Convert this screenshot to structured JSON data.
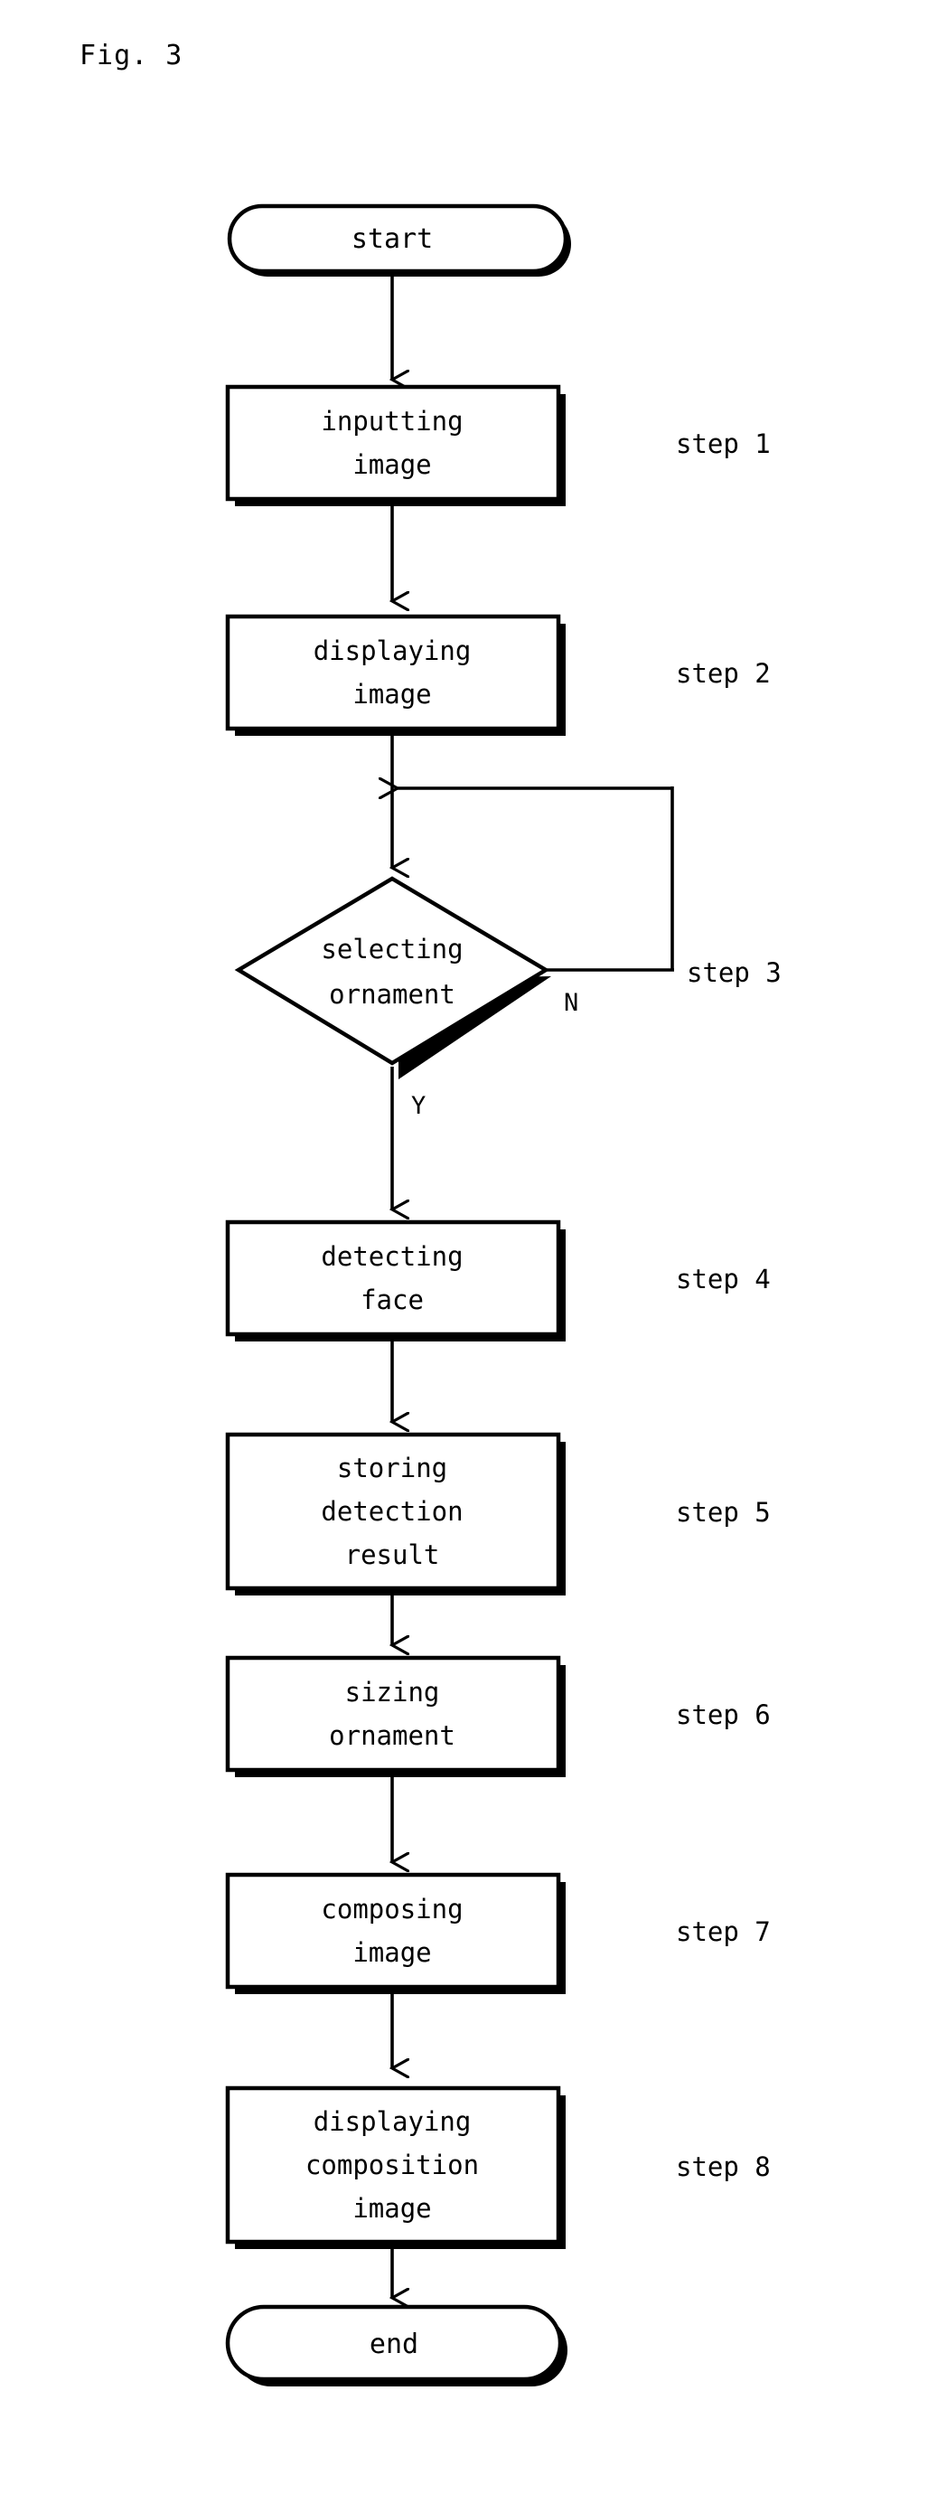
{
  "figure": {
    "title": "Fig. 3",
    "type": "flowchart"
  },
  "chart_data": {
    "type": "diagram",
    "title": "Fig. 3",
    "nodes": [
      {
        "id": "start",
        "shape": "stadium",
        "text": [
          "start"
        ],
        "step": null
      },
      {
        "id": "s1",
        "shape": "process",
        "text": [
          "inputting",
          "image"
        ],
        "step": "step 1"
      },
      {
        "id": "s2",
        "shape": "process",
        "text": [
          "displaying",
          "image"
        ],
        "step": "step 2"
      },
      {
        "id": "s3",
        "shape": "decision",
        "text": [
          "selecting",
          "ornament"
        ],
        "step": "step 3"
      },
      {
        "id": "s4",
        "shape": "process",
        "text": [
          "detecting",
          "face"
        ],
        "step": "step 4"
      },
      {
        "id": "s5",
        "shape": "process",
        "text": [
          "storing",
          "detection",
          "result"
        ],
        "step": "step 5"
      },
      {
        "id": "s6",
        "shape": "process",
        "text": [
          "sizing",
          "ornament"
        ],
        "step": "step 6"
      },
      {
        "id": "s7",
        "shape": "process",
        "text": [
          "composing",
          "image"
        ],
        "step": "step 7"
      },
      {
        "id": "s8",
        "shape": "process",
        "text": [
          "displaying",
          "composition",
          "image"
        ],
        "step": "step 8"
      },
      {
        "id": "end",
        "shape": "stadium",
        "text": [
          "end"
        ],
        "step": null
      }
    ],
    "edges": [
      {
        "from": "start",
        "to": "s1",
        "label": ""
      },
      {
        "from": "s1",
        "to": "s2",
        "label": ""
      },
      {
        "from": "s2",
        "to": "s3",
        "label": ""
      },
      {
        "from": "s3",
        "to": "s4",
        "label": "Y"
      },
      {
        "from": "s3",
        "to": "s2-s3-link",
        "label": "N"
      },
      {
        "from": "s4",
        "to": "s5",
        "label": ""
      },
      {
        "from": "s5",
        "to": "s6",
        "label": ""
      },
      {
        "from": "s6",
        "to": "s7",
        "label": ""
      },
      {
        "from": "s7",
        "to": "s8",
        "label": ""
      },
      {
        "from": "s8",
        "to": "end",
        "label": ""
      }
    ]
  },
  "nodes": {
    "start": {
      "line1": "start"
    },
    "step1": {
      "line1": "inputting",
      "line2": "image",
      "label": "step 1"
    },
    "step2": {
      "line1": "displaying",
      "line2": "image",
      "label": "step 2"
    },
    "step3": {
      "line1": "selecting",
      "line2": "ornament",
      "label": "step 3",
      "yes": "Y",
      "no": "N"
    },
    "step4": {
      "line1": "detecting",
      "line2": "face",
      "label": "step 4"
    },
    "step5": {
      "line1": "storing",
      "line2": "detection",
      "line3": "result",
      "label": "step 5"
    },
    "step6": {
      "line1": "sizing",
      "line2": "ornament",
      "label": "step 6"
    },
    "step7": {
      "line1": "composing",
      "line2": "image",
      "label": "step 7"
    },
    "step8": {
      "line1": "displaying",
      "line2": "composition",
      "line3": "image",
      "label": "step 8"
    },
    "end": {
      "line1": "end"
    }
  },
  "colors": {
    "stroke": "#000000",
    "fill": "#ffffff",
    "background": "#ffffff"
  }
}
